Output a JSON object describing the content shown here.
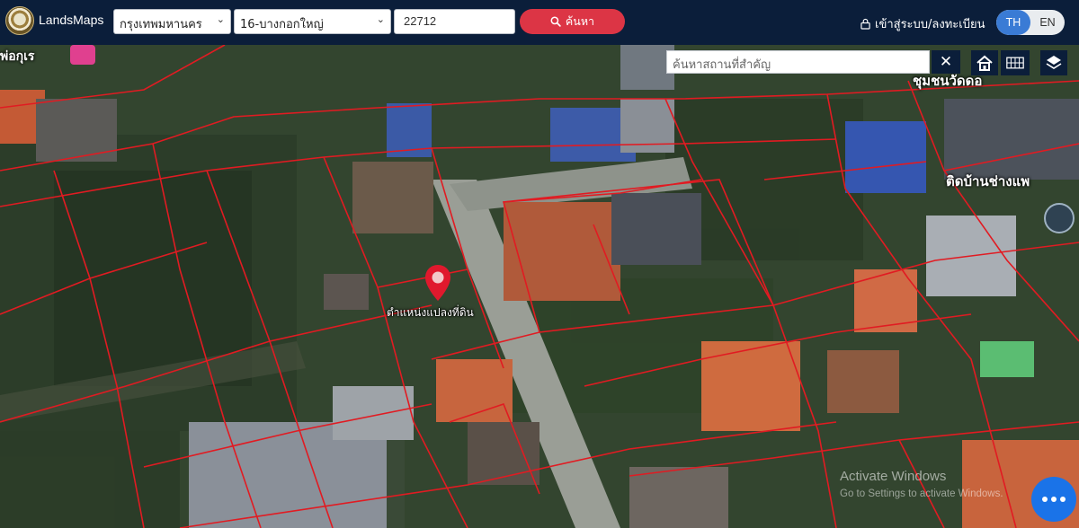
{
  "header": {
    "brand": "LandsMaps",
    "province": "กรุงเทพมหานคร",
    "district": "16-บางกอกใหญ่",
    "parcel_number": "22712",
    "search_label": "ค้นหา",
    "login_label": "เข้าสู่ระบบ/ลงทะเบียน",
    "lang_th": "TH",
    "lang_en": "EN",
    "active_lang": "TH"
  },
  "map": {
    "place_search_placeholder": "ค้นหาสถานที่สำคัญ",
    "clear_label": "✕",
    "marker_label": "ตำแหน่งแปลงที่ดิน",
    "labels": {
      "top_left": "พ่อกุเร",
      "right_top": "ชุมชนวัดดอ",
      "right_mid": "ติดบ้านช่างแพ"
    },
    "watermark": {
      "line1": "Activate Windows",
      "line2": "Go to Settings to activate Windows."
    },
    "colors": {
      "parcel_lines": "#e11b22",
      "marker": "#e0192d",
      "header_bg": "#0b1e3a",
      "search_button": "#dc3545",
      "lang_active": "#3a7bd5",
      "chat": "#1a73e8"
    }
  },
  "icons": [
    "seal-logo-icon",
    "search-icon",
    "lock-icon",
    "home-icon",
    "grid-icon",
    "layers-icon",
    "location-pin-icon",
    "chat-icon"
  ]
}
